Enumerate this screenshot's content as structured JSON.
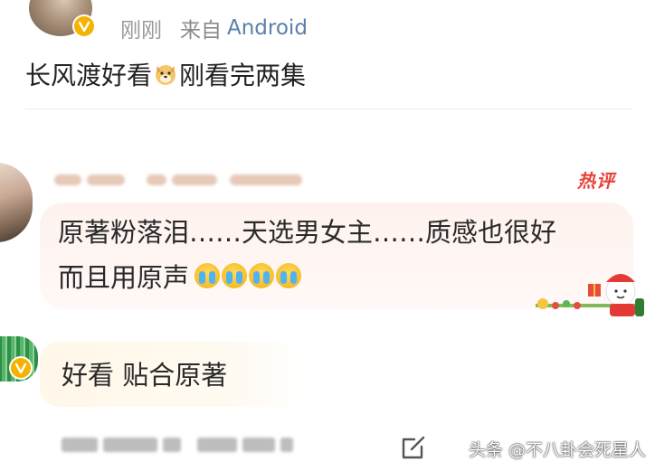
{
  "post": {
    "time": "刚刚",
    "source_prefix": "来自",
    "source_platform": "Android",
    "text_before": "长风渡好看",
    "emoji": "dog-face-emoji",
    "text_after": "刚看完两集"
  },
  "hot_comment": {
    "badge": "热评",
    "line1": "原著粉落泪……天选男女主……质感也很好",
    "line2": "而且用原声",
    "cry_emoji_count": 4,
    "decoration": "christmas-snowman-sticker"
  },
  "comment2": {
    "text": "好看 贴合原著"
  },
  "footer": {
    "watermark": "头条 @不八卦会死星人"
  },
  "colors": {
    "accent_link": "#5b7fa8",
    "hot_red": "#e8433b",
    "verified_gold": "#f5b300",
    "bubble_pink": "#fdf2ee",
    "bubble_cream": "#fff7e8"
  }
}
